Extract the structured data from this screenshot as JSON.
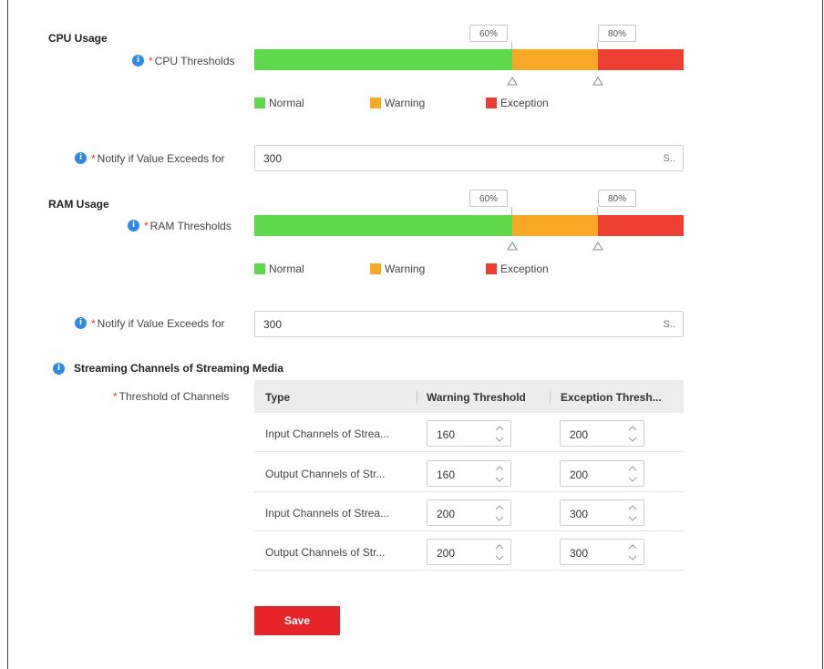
{
  "cpu": {
    "title": "CPU Usage",
    "threshold_label": "CPU Thresholds",
    "required_mark": "*",
    "warning_threshold": "60%",
    "exception_threshold": "80%",
    "warning_fraction": 0.6,
    "exception_fraction": 0.8,
    "legend": {
      "normal": "Normal",
      "warning": "Warning",
      "exception": "Exception"
    },
    "notify_label": "Notify if Value Exceeds for",
    "notify_value": "300",
    "notify_unit": "S.."
  },
  "ram": {
    "title": "RAM Usage",
    "threshold_label": "RAM Thresholds",
    "required_mark": "*",
    "warning_threshold": "60%",
    "exception_threshold": "80%",
    "warning_fraction": 0.6,
    "exception_fraction": 0.8,
    "legend": {
      "normal": "Normal",
      "warning": "Warning",
      "exception": "Exception"
    },
    "notify_label": "Notify if Value Exceeds for",
    "notify_value": "300",
    "notify_unit": "S.."
  },
  "streaming": {
    "title": "Streaming Channels of Streaming Media",
    "threshold_label": "Threshold of Channels",
    "required_mark": "*",
    "columns": [
      "Type",
      "Warning Threshold",
      "Exception Thresh..."
    ],
    "rows": [
      {
        "type": "Input Channels of Strea...",
        "warning": "160",
        "exception": "200"
      },
      {
        "type": "Output Channels of Str...",
        "warning": "160",
        "exception": "200"
      },
      {
        "type": "Input Channels of Strea...",
        "warning": "200",
        "exception": "300"
      },
      {
        "type": "Output Channels of Str...",
        "warning": "200",
        "exception": "300"
      }
    ]
  },
  "actions": {
    "save_label": "Save"
  },
  "colors": {
    "normal": "#5ed94b",
    "warning": "#f7a926",
    "exception": "#ef3f33",
    "primary_button": "#e8242b",
    "info": "#2f8ae5"
  }
}
